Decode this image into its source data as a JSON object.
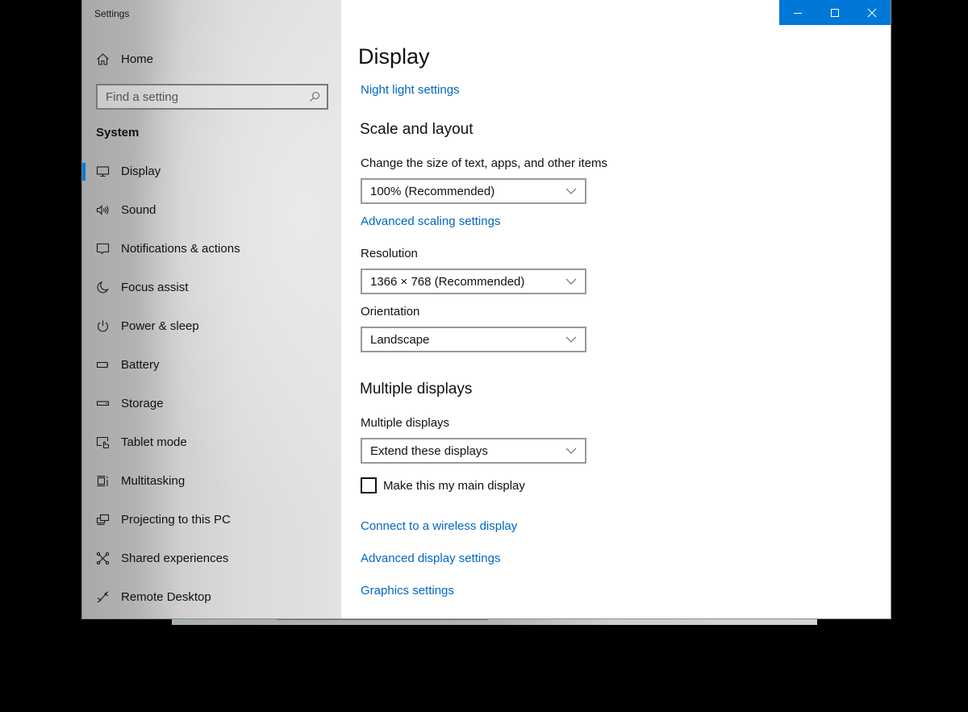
{
  "window": {
    "title": "Settings",
    "controls": {
      "minimize": "minimize-icon",
      "maximize": "maximize-icon",
      "close": "close-icon"
    },
    "accent_color": "#0078d7"
  },
  "sidebar": {
    "home": {
      "label": "Home",
      "icon": "home-icon"
    },
    "search": {
      "placeholder": "Find a setting",
      "value": "",
      "icon": "search-icon"
    },
    "group_title": "System",
    "items": [
      {
        "label": "Display",
        "icon": "monitor-icon",
        "selected": true
      },
      {
        "label": "Sound",
        "icon": "speaker-icon",
        "selected": false
      },
      {
        "label": "Notifications & actions",
        "icon": "notification-icon",
        "selected": false
      },
      {
        "label": "Focus assist",
        "icon": "moon-icon",
        "selected": false
      },
      {
        "label": "Power & sleep",
        "icon": "power-icon",
        "selected": false
      },
      {
        "label": "Battery",
        "icon": "battery-icon",
        "selected": false
      },
      {
        "label": "Storage",
        "icon": "storage-icon",
        "selected": false
      },
      {
        "label": "Tablet mode",
        "icon": "tablet-mode-icon",
        "selected": false
      },
      {
        "label": "Multitasking",
        "icon": "multitasking-icon",
        "selected": false
      },
      {
        "label": "Projecting to this PC",
        "icon": "projecting-icon",
        "selected": false
      },
      {
        "label": "Shared experiences",
        "icon": "shared-experiences-icon",
        "selected": false
      },
      {
        "label": "Remote Desktop",
        "icon": "remote-desktop-icon",
        "selected": false
      }
    ]
  },
  "main": {
    "title": "Display",
    "night_light_link": "Night light settings",
    "scale_section": {
      "title": "Scale and layout",
      "size_label": "Change the size of text, apps, and other items",
      "size_value": "100% (Recommended)",
      "advanced_scaling_link": "Advanced scaling settings",
      "resolution_label": "Resolution",
      "resolution_value": "1366 × 768 (Recommended)",
      "orientation_label": "Orientation",
      "orientation_value": "Landscape"
    },
    "multiple_section": {
      "title": "Multiple displays",
      "label": "Multiple displays",
      "value": "Extend these displays",
      "main_display_checkbox": {
        "label": "Make this my main display",
        "checked": false
      }
    },
    "links": {
      "wireless": "Connect to a wireless display",
      "advanced_display": "Advanced display settings",
      "graphics": "Graphics settings"
    }
  }
}
